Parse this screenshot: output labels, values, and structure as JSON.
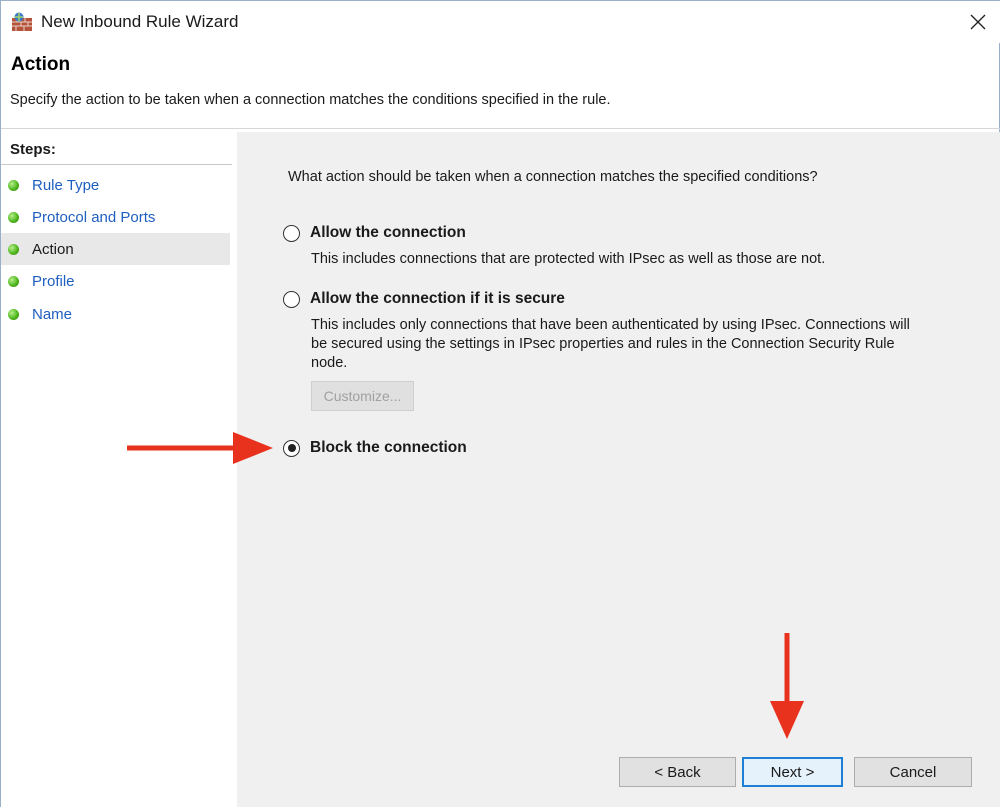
{
  "window": {
    "title": "New Inbound Rule Wizard",
    "icon": "firewall-icon"
  },
  "header": {
    "title": "Action",
    "description": "Specify the action to be taken when a connection matches the conditions specified in the rule."
  },
  "steps": {
    "label": "Steps:",
    "items": [
      {
        "label": "Rule Type"
      },
      {
        "label": "Protocol and Ports"
      },
      {
        "label": "Action"
      },
      {
        "label": "Profile"
      },
      {
        "label": "Name"
      }
    ],
    "current": "Action"
  },
  "content": {
    "question": "What action should be taken when a connection matches the specified conditions?",
    "options": [
      {
        "label": "Allow the connection",
        "description": "This includes connections that are protected with IPsec as well as those are not.",
        "selected": false
      },
      {
        "label": "Allow the connection if it is secure",
        "description": "This includes only connections that have been authenticated by using IPsec.  Connections will be secured using the settings in IPsec properties and rules in the Connection Security Rule node.",
        "selected": false
      },
      {
        "label": "Block the connection",
        "description": "",
        "selected": true
      }
    ],
    "customize_label": "Customize..."
  },
  "buttons": {
    "back": "< Back",
    "next": "Next >",
    "cancel": "Cancel"
  },
  "colors": {
    "link": "#1f5fbf",
    "annotation_arrow": "#e8321e",
    "content_bg": "#f0f0f0",
    "default_button_border": "#1f7fd6"
  }
}
